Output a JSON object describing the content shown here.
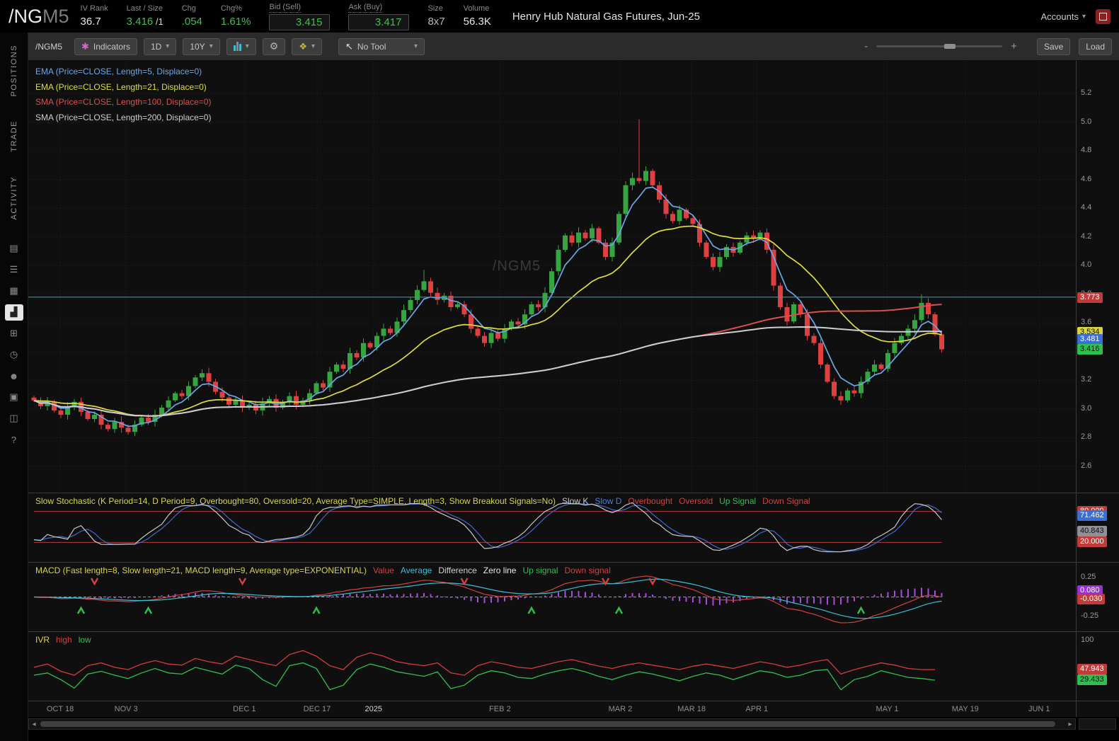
{
  "header": {
    "symbol": "/NG",
    "symbol_suffix": "M5",
    "fields": [
      {
        "label": "IV Rank",
        "value": "36.7",
        "color": "white"
      },
      {
        "label": "Last / Size",
        "value": "3.416",
        "suffix": " /1",
        "color": "green"
      },
      {
        "label": "Chg",
        "value": ".054",
        "color": "green"
      },
      {
        "label": "Chg%",
        "value": "1.61%",
        "color": "green"
      },
      {
        "label": "Bid (Sell)",
        "value": "3.415",
        "color": "green",
        "boxed": true
      },
      {
        "label": "Ask (Buy)",
        "value": "3.417",
        "color": "green",
        "boxed": true
      },
      {
        "label": "Size",
        "value": "8x7",
        "color": "dim"
      },
      {
        "label": "Volume",
        "value": "56.3K",
        "color": "white"
      }
    ],
    "title": "Henry Hub Natural Gas Futures, Jun-25",
    "accounts_label": "Accounts"
  },
  "sidebar": {
    "tabs": [
      "POSITIONS",
      "TRADE",
      "ACTIVITY"
    ],
    "icons": [
      {
        "name": "document",
        "glyph": "▤"
      },
      {
        "name": "list",
        "glyph": "☰"
      },
      {
        "name": "calendar",
        "glyph": "▦"
      },
      {
        "name": "chart",
        "glyph": "▟",
        "active": true
      },
      {
        "name": "grid",
        "glyph": "⊞"
      },
      {
        "name": "clock",
        "glyph": "◷"
      },
      {
        "name": "users",
        "glyph": "☻"
      },
      {
        "name": "package",
        "glyph": "▣"
      },
      {
        "name": "widget",
        "glyph": "◫"
      },
      {
        "name": "help",
        "glyph": "?"
      }
    ]
  },
  "toolbar": {
    "symbol_label": "/NGM5",
    "indicators_label": "Indicators",
    "timeframe": "1D",
    "range": "10Y",
    "tool_label": "No Tool",
    "zoom_minus": "-",
    "zoom_plus": "+",
    "save_label": "Save",
    "load_label": "Load"
  },
  "icons": {
    "chevron_down": "▾",
    "gear": "⚙",
    "indicators": "✱",
    "draw": "❖",
    "cursor": "↖",
    "scroll_left": "◂",
    "scroll_right": "▸"
  },
  "studies": {
    "main_labels": [
      {
        "text": "EMA (Price=CLOSE, Length=5, Displace=0)",
        "color": "#6aa6e8",
        "kind": "EMA",
        "length": 5
      },
      {
        "text": "EMA (Price=CLOSE, Length=21, Displace=0)",
        "color": "#e0dc3e",
        "kind": "EMA",
        "length": 21
      },
      {
        "text": "SMA (Price=CLOSE, Length=100, Displace=0)",
        "color": "#d94f4f",
        "kind": "SMA",
        "length": 100
      },
      {
        "text": "SMA (Price=CLOSE, Length=200, Displace=0)",
        "color": "#c9ced4",
        "kind": "SMA",
        "length": 200
      }
    ]
  },
  "chart_data": {
    "type": "candlestick",
    "title": "Henry Hub Natural Gas Futures, Jun-25",
    "watermark": "/NGM5",
    "up_color": "#35a53f",
    "down_color": "#de4040",
    "price_axis": {
      "ticks": [
        5.2,
        5.0,
        4.8,
        4.6,
        4.4,
        4.2,
        4.0,
        3.8,
        3.6,
        3.4,
        3.2,
        3.0,
        2.8,
        2.6
      ]
    },
    "x_axis_ticks": [
      {
        "label": "OCT 18",
        "i": 3.9
      },
      {
        "label": "NOV 3",
        "i": 13.7
      },
      {
        "label": "DEC 1",
        "i": 31.3
      },
      {
        "label": "DEC 17",
        "i": 42.1
      },
      {
        "label": "2025",
        "i": 50.5,
        "bright": true
      },
      {
        "label": "FEB 2",
        "i": 69.3
      },
      {
        "label": "MAR 2",
        "i": 87.2
      },
      {
        "label": "MAR 18",
        "i": 97.8
      },
      {
        "label": "APR 1",
        "i": 107.5
      },
      {
        "label": "MAY 1",
        "i": 126.9
      },
      {
        "label": "MAY 19",
        "i": 138.5
      },
      {
        "label": "JUN 1",
        "i": 149.5
      }
    ],
    "first_open": 3.08,
    "candles_close": [
      3.06,
      3.02,
      3.05,
      2.99,
      2.96,
      3.01,
      3.05,
      2.98,
      2.93,
      2.96,
      2.89,
      2.86,
      2.91,
      2.87,
      2.84,
      2.89,
      2.94,
      2.91,
      2.96,
      3.01,
      3.06,
      3.11,
      3.09,
      3.16,
      3.22,
      3.25,
      3.19,
      3.12,
      3.08,
      3.03,
      3.06,
      3.01,
      3.03,
      2.99,
      3.04,
      3.07,
      3.01,
      3.05,
      3.09,
      3.03,
      3.06,
      3.11,
      3.18,
      3.15,
      3.26,
      3.31,
      3.28,
      3.39,
      3.36,
      3.46,
      3.43,
      3.51,
      3.56,
      3.53,
      3.61,
      3.69,
      3.76,
      3.83,
      3.89,
      3.81,
      3.76,
      3.79,
      3.71,
      3.73,
      3.66,
      3.56,
      3.51,
      3.46,
      3.53,
      3.49,
      3.56,
      3.61,
      3.59,
      3.66,
      3.73,
      3.71,
      3.81,
      3.96,
      4.11,
      4.21,
      4.16,
      4.23,
      4.19,
      4.26,
      4.16,
      4.06,
      4.16,
      4.36,
      4.56,
      4.61,
      4.59,
      4.66,
      4.56,
      4.46,
      4.36,
      4.31,
      4.39,
      4.33,
      4.29,
      4.16,
      4.06,
      3.99,
      4.06,
      4.13,
      4.09,
      4.16,
      4.21,
      4.19,
      4.23,
      4.11,
      3.86,
      3.71,
      3.61,
      3.73,
      3.66,
      3.51,
      3.46,
      3.31,
      3.19,
      3.09,
      3.06,
      3.13,
      3.11,
      3.19,
      3.26,
      3.31,
      3.28,
      3.39,
      3.46,
      3.51,
      3.56,
      3.62,
      3.74,
      3.66,
      3.52,
      3.416
    ],
    "wick_high_overrides": {
      "58": 3.97,
      "90": 5.02,
      "132": 3.8
    },
    "horizontal_line_price": 3.78,
    "horizontal_line_color": "#3d95b0",
    "price_badges": [
      {
        "text": "3.773",
        "price": 3.773,
        "bg": "#c23a3a",
        "fg": "#ffffff"
      },
      {
        "text": "3.534",
        "price": 3.534,
        "bg": "#d9d43e",
        "fg": "#111111"
      },
      {
        "text": "3.481",
        "price": 3.481,
        "bg": "#3b6fd4",
        "fg": "#ffffff"
      },
      {
        "text": "3.416",
        "price": 3.416,
        "bg": "#2fbf4f",
        "fg": "#111111"
      }
    ],
    "stochastic": {
      "title": "Slow Stochastic (K Period=14, D Period=9, Overbought=80, Oversold=20, Average Type=SIMPLE, Length=3, Show Breakout Signals=No)",
      "legend": [
        {
          "text": "Slow K",
          "color": "#c8c8c8"
        },
        {
          "text": "Slow D",
          "color": "#4a7fe0"
        },
        {
          "text": "Overbought",
          "color": "#d24040"
        },
        {
          "text": "Oversold",
          "color": "#d24040"
        },
        {
          "text": "Up Signal",
          "color": "#2fbf4f"
        },
        {
          "text": "Down Signal",
          "color": "#d24040"
        }
      ],
      "overbought": 80,
      "oversold": 20,
      "k_color": "#c8c8c8",
      "d_color": "#4169c8",
      "band_color": "#b23b3b",
      "badges": [
        {
          "text": "80.000",
          "v": 80,
          "bg": "#c23a3a",
          "fg": "#ffffff"
        },
        {
          "text": "71.462",
          "v": 71.462,
          "bg": "#3b6fd4",
          "fg": "#ffffff"
        },
        {
          "text": "40.843",
          "v": 40.843,
          "bg": "#8d9196",
          "fg": "#111111"
        },
        {
          "text": "20.000",
          "v": 20,
          "bg": "#c23a3a",
          "fg": "#ffffff"
        }
      ]
    },
    "macd": {
      "title": "MACD (Fast length=8, Slow length=21, MACD length=9, Average type=EXPONENTIAL)",
      "legend": [
        {
          "text": "Value",
          "color": "#d24040"
        },
        {
          "text": "Average",
          "color": "#3bbdd4"
        },
        {
          "text": "Difference",
          "color": "#cfcfcf"
        },
        {
          "text": "Zero line",
          "color": "#e8e8e8"
        },
        {
          "text": "Up signal",
          "color": "#2fbf4f"
        },
        {
          "text": "Down signal",
          "color": "#d24040"
        }
      ],
      "fast": 8,
      "slow": 21,
      "smooth": 9,
      "value_color": "#d24040",
      "average_color": "#3bbdd4",
      "hist_color": "#a84ae0",
      "ticks": [
        0.25,
        -0.25
      ],
      "badges": [
        {
          "text": "0.080",
          "v": 0.08,
          "bg": "#9b30d9",
          "fg": "#ffffff"
        },
        {
          "text": "-0.030",
          "v": -0.03,
          "bg": "#c23a3a",
          "fg": "#ffffff"
        }
      ],
      "up_signals": [
        7,
        17,
        42,
        74,
        87,
        123
      ],
      "down_signals": [
        9,
        31,
        64,
        85,
        92
      ],
      "up_color": "#2fbf4f",
      "down_color": "#d24040"
    },
    "ivr": {
      "title": "IVR",
      "legend": [
        {
          "text": "high",
          "color": "#d24040"
        },
        {
          "text": "low",
          "color": "#2fbf4f"
        }
      ],
      "high_color": "#d43b3b",
      "low_color": "#2fbf4f",
      "ticks": [
        100
      ],
      "badges": [
        {
          "text": "47.943",
          "v": 47.943,
          "bg": "#c23a3a",
          "fg": "#ffffff"
        },
        {
          "text": "29.433",
          "v": 29.433,
          "bg": "#2fbf4f",
          "fg": "#111111"
        }
      ],
      "step": 2,
      "high": [
        52,
        58,
        45,
        38,
        55,
        60,
        52,
        48,
        58,
        64,
        58,
        56,
        68,
        62,
        58,
        72,
        66,
        60,
        55,
        75,
        82,
        72,
        55,
        48,
        70,
        78,
        72,
        62,
        58,
        55,
        60,
        42,
        38,
        55,
        62,
        58,
        52,
        50,
        56,
        62,
        66,
        60,
        54,
        50,
        56,
        60,
        56,
        52,
        48,
        54,
        58,
        54,
        50,
        56,
        62,
        58,
        52,
        56,
        62,
        66,
        40,
        48,
        54,
        60,
        56,
        50,
        48,
        48
      ],
      "low": [
        38,
        42,
        30,
        15,
        40,
        45,
        38,
        32,
        42,
        50,
        42,
        40,
        52,
        46,
        40,
        56,
        50,
        30,
        18,
        55,
        60,
        50,
        12,
        20,
        48,
        58,
        52,
        44,
        40,
        36,
        44,
        14,
        20,
        38,
        46,
        42,
        34,
        32,
        40,
        46,
        50,
        44,
        36,
        30,
        38,
        44,
        40,
        34,
        28,
        36,
        42,
        38,
        30,
        38,
        46,
        42,
        34,
        38,
        46,
        48,
        12,
        30,
        36,
        46,
        40,
        34,
        32,
        29
      ]
    }
  }
}
